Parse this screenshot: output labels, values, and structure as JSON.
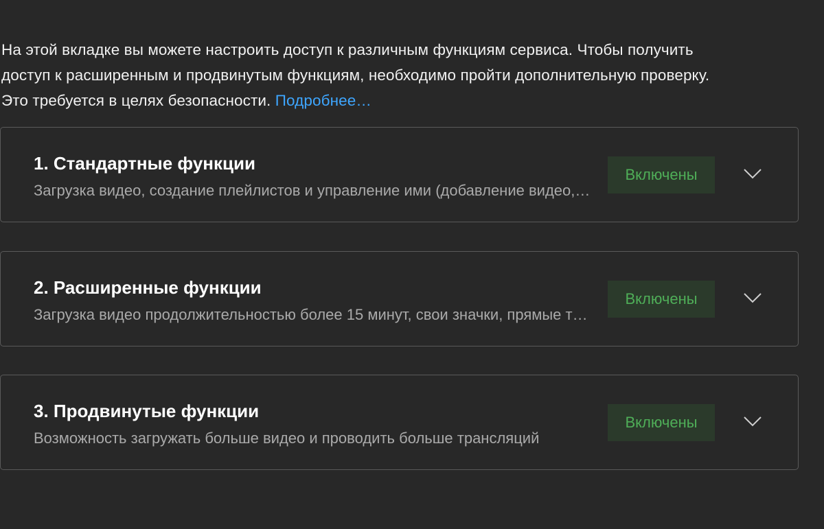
{
  "intro": {
    "line1": "На этой вкладке вы можете настроить доступ к различным функциям сервиса. Чтобы получить",
    "line2": "доступ к расширенным и продвинутым функциям, необходимо пройти дополнительную проверку.",
    "line3": "Это требуется в целях безопасности.",
    "link": "Подробнее…"
  },
  "cards": [
    {
      "title": "1. Стандартные функции",
      "description": "Загрузка видео, создание плейлистов и управление ими (добавление видео, изменение порядка и т. д.)",
      "status": "Включены",
      "icon": "chevron-down-icon"
    },
    {
      "title": "2. Расширенные функции",
      "description": "Загрузка видео продолжительностью более 15 минут, свои значки, прямые трансляции",
      "status": "Включены",
      "icon": "chevron-down-icon"
    },
    {
      "title": "3. Продвинутые функции",
      "description": "Возможность загружать больше видео и проводить больше трансляций",
      "status": "Включены",
      "icon": "chevron-down-icon"
    }
  ],
  "colors": {
    "background": "#282828",
    "text": "#f1f1f1",
    "muted": "#aaaaaa",
    "link": "#3ea6ff",
    "status_text": "#4fae58",
    "status_bg": "#2b3a2b",
    "border": "#5a5a5a"
  }
}
